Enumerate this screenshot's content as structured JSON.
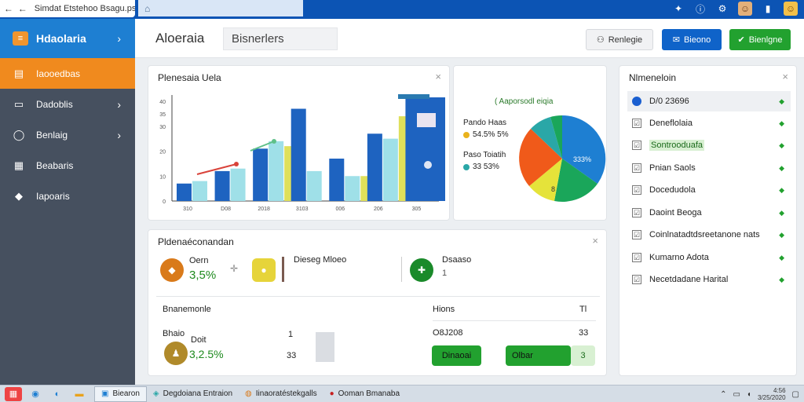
{
  "browser": {
    "tab_title": "Simdat Etstehoo Bsagu.ps",
    "back_icon": "←",
    "forward_icon": "←",
    "address_icon": "⌂"
  },
  "sidebar": {
    "title": "Hdaolaria",
    "items": [
      {
        "label": "Iaooedbas",
        "icon": "▤",
        "active": true,
        "chevron": false
      },
      {
        "label": "Dadoblis",
        "icon": "▭",
        "active": false,
        "chevron": true
      },
      {
        "label": "Benlaig",
        "icon": "◯",
        "active": false,
        "chevron": true
      },
      {
        "label": "Beabaris",
        "icon": "▦",
        "active": false,
        "chevron": false
      },
      {
        "label": "Iapoaris",
        "icon": "◆",
        "active": false,
        "chevron": false
      }
    ]
  },
  "header": {
    "title": "Aloeraia",
    "search_value": "Bisnerlers",
    "btn_grey": "Renlegie",
    "btn_blue": "Bieono",
    "btn_green": "Bienlgne"
  },
  "chart_card": {
    "title": "Plenesaia Uela",
    "close": "×"
  },
  "chart_data": {
    "type": "bar",
    "title": "Plenesaia Uela",
    "ylim": [
      0,
      40
    ],
    "yticks": [
      "0",
      "10",
      "20",
      "30",
      "35",
      "40"
    ],
    "categories": [
      "310",
      "D08",
      "2018",
      "3103",
      "006",
      "206",
      "305"
    ],
    "series": [
      {
        "color": "#1e63c0",
        "values": [
          7,
          12,
          21,
          37,
          17,
          27,
          42
        ]
      },
      {
        "color": "#9fe0e8",
        "values": [
          8,
          13,
          24,
          12,
          10,
          25,
          35
        ]
      },
      {
        "color": "#dfe05a",
        "values": [
          0,
          0,
          22,
          0,
          10,
          34,
          0
        ]
      }
    ],
    "annotation_line": {
      "color": "#d9433a"
    },
    "annotation_line2": {
      "color": "#5fc089"
    }
  },
  "pie_card": {
    "legend_title": "( Aaporsodl eiqia",
    "label1": "Pando Haas",
    "value1": "54.5% 5%",
    "label2": "Paso Toiatih",
    "value2": "33 53%",
    "slice_label": "333%",
    "slice_label2": "8",
    "colors": {
      "blue": "#1e7fd2",
      "green": "#1aa65a",
      "orange": "#f05a1a",
      "yellow": "#e5e33a",
      "teal": "#2aa7a7"
    }
  },
  "right_panel": {
    "title": "Nlmeneloin",
    "close": "×",
    "rows": [
      {
        "label": "D/0 23696",
        "highlight": true,
        "marker": "dot"
      },
      {
        "label": "Deneflolaia",
        "highlight": false,
        "marker": "box"
      },
      {
        "label": "Sontrooduafa",
        "highlight": false,
        "marker": "box",
        "green": true
      },
      {
        "label": "Pnian Saols",
        "highlight": false,
        "marker": "box"
      },
      {
        "label": "Docedudola",
        "highlight": false,
        "marker": "box"
      },
      {
        "label": "Daoint Beoga",
        "highlight": false,
        "marker": "box"
      },
      {
        "label": "Coinlnatadtdsreetanone nats",
        "highlight": false,
        "marker": "box"
      },
      {
        "label": "Kumarno Adota",
        "highlight": false,
        "marker": "box"
      },
      {
        "label": "Necetdadane Harital",
        "highlight": false,
        "marker": "box"
      }
    ]
  },
  "bottom_card": {
    "title": "Pldenaéconandan",
    "close": "×",
    "stat1_label": "Oern",
    "stat1_value": "3,5%",
    "stat2_label": "Dieseg Mloeo",
    "stat3_label": "Dsaaso",
    "stat3_value": "1",
    "section_left": "Bnanemonle",
    "section_right": "Hions",
    "section_right_meta": "Tl",
    "row_label": "Bhaio",
    "row_sub": "Doit",
    "row_value": "3,2.5%",
    "row_n1": "1",
    "row_n2": "33",
    "right_row_label": "O8J208",
    "right_row_value": "33",
    "btn1": "Dinaoai",
    "btn2": "Olbar",
    "btn2_suffix": "3"
  },
  "taskbar": {
    "app1": "Biearon",
    "app2": "Degdoiana Entraion",
    "app3": "Iinaoratéstekgalls",
    "app4": "Ooman Bmanaba",
    "tray_time": "4:56",
    "tray_date": "3/25/2020"
  }
}
